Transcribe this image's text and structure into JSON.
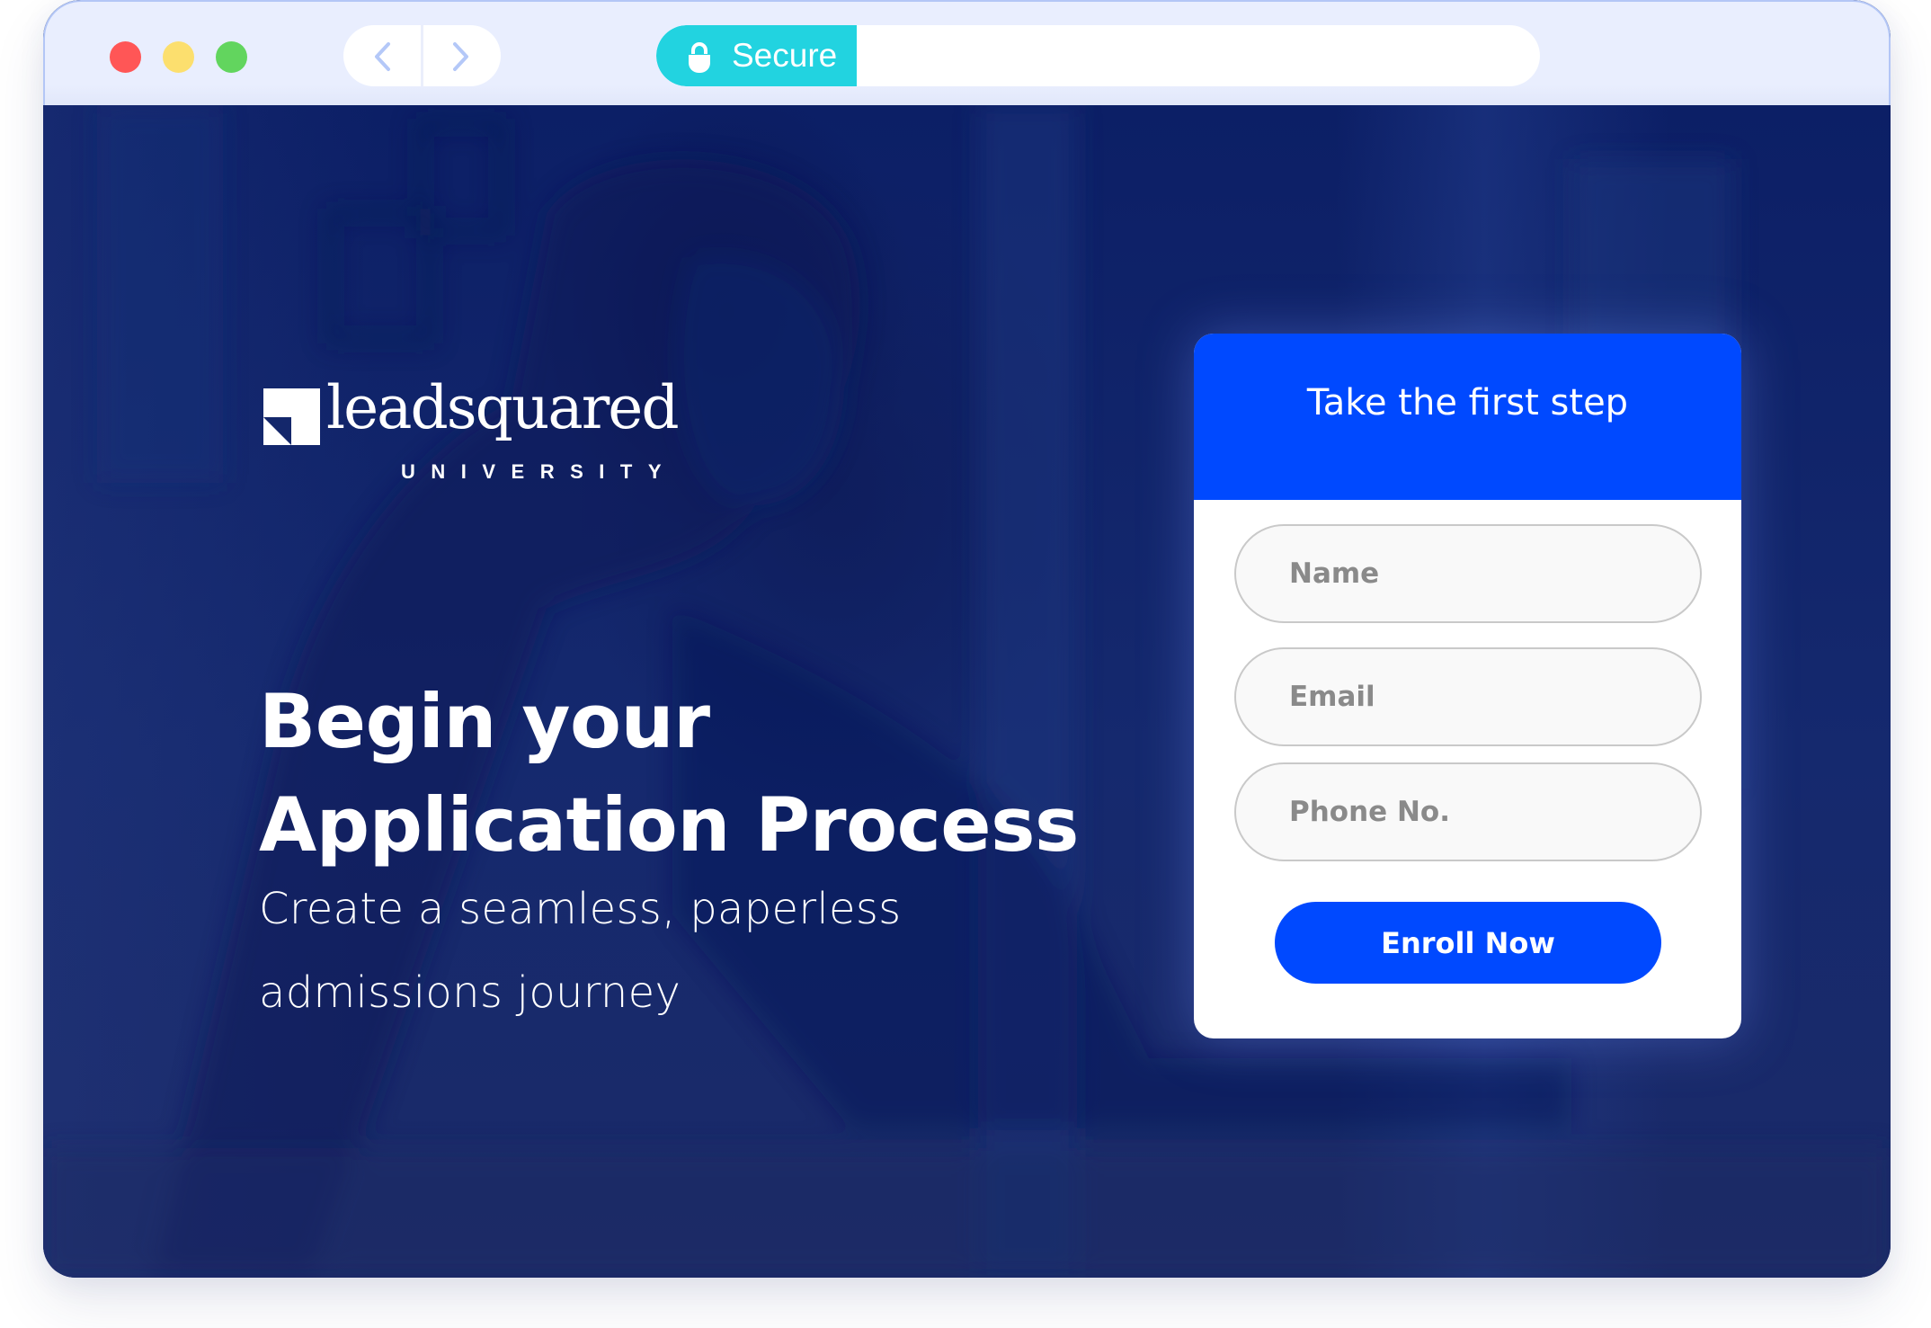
{
  "browser": {
    "traffic_lights": [
      "close",
      "minimize",
      "maximize"
    ],
    "nav": {
      "back_icon": "chevron-left-icon",
      "forward_icon": "chevron-right-icon"
    },
    "security_badge": {
      "icon": "lock-icon",
      "label": "Secure"
    },
    "url": ""
  },
  "brand": {
    "name": "leadsquared",
    "tagline": "UNIVERSITY"
  },
  "hero": {
    "heading_line1": "Begin your",
    "heading_line2": "Application Process",
    "subtitle_line1": "Create a seamless, paperless",
    "subtitle_line2": "admissions journey"
  },
  "form": {
    "title": "Take the first step",
    "fields": [
      {
        "placeholder": "Name",
        "value": ""
      },
      {
        "placeholder": "Email",
        "value": ""
      },
      {
        "placeholder": "Phone No.",
        "value": ""
      }
    ],
    "submit_label": "Enroll Now"
  },
  "colors": {
    "primary_blue": "#0049FF",
    "secure_teal": "#22D3E0",
    "hero_navy": "#0E1F63",
    "chrome_bg": "#E9EEFE",
    "traffic_red": "#FF5656",
    "traffic_yellow": "#FCDF6E",
    "traffic_green": "#62D55E"
  }
}
